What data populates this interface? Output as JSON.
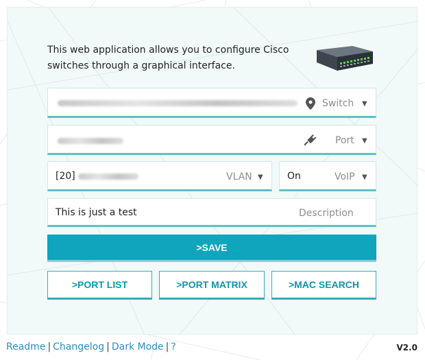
{
  "intro_text": "This web application allows you to configure Cisco switches through a graphical interface.",
  "switch_field": {
    "label": "Switch",
    "icon": "location-pin-icon"
  },
  "port_field": {
    "label": "Port",
    "icon": "plug-icon"
  },
  "vlan_field": {
    "value_prefix": "[20]",
    "label": "VLAN"
  },
  "voip_field": {
    "value": "On",
    "label": "VoIP"
  },
  "description_field": {
    "value": "This is just a test",
    "placeholder": "Description"
  },
  "buttons": {
    "save": ">SAVE",
    "port_list": ">PORT LIST",
    "port_matrix": ">PORT MATRIX",
    "mac_search": ">MAC SEARCH"
  },
  "footer": {
    "links": [
      "Readme",
      "Changelog",
      "Dark Mode",
      "?"
    ],
    "separator": "|",
    "version": "V2.0"
  },
  "colors": {
    "accent": "#0ea5bd",
    "panel_bg": "#f1faf9",
    "link": "#2a8ec2"
  }
}
